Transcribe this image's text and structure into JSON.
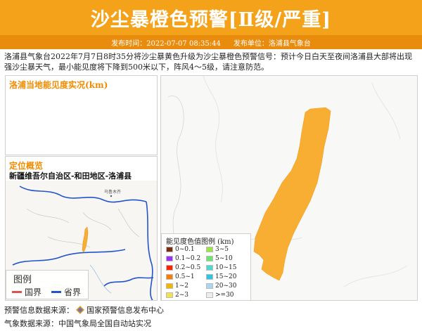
{
  "header": {
    "title": "沙尘暴橙色预警[Ⅱ级/严重]",
    "publish_time": "发布时间：2022-07-07 08:35:44",
    "publisher": "发布单位：洛浦县气象台"
  },
  "summary": "洛浦县气象台2022年7月7日8时35分将沙尘暴黄色升级为沙尘暴橙色预警信号：预计今日白天至夜间洛浦县大部将出现强沙尘暴天气，最小能见度将下降到500米以下，阵风4～5级，请注意防范。",
  "visibility_panel": {
    "title": "洛浦当地能见度实况(km)"
  },
  "location_panel": {
    "title": "定位概览",
    "region": "新疆维吾尔自治区-和田地区-洛浦县",
    "city_label": "乌鲁木齐",
    "legend": {
      "title": "图例",
      "national_border": "国界",
      "provincial_border": "省界",
      "national_color": "#d9534f",
      "provincial_color": "#2255cc"
    }
  },
  "visibility_legend": {
    "title": "能见度色值图例 (km)",
    "items": [
      {
        "label": "0~0.1",
        "color": "#7b2d12"
      },
      {
        "label": "3~5",
        "color": "#9ee24a"
      },
      {
        "label": "0.1~0.2",
        "color": "#9b30ff"
      },
      {
        "label": "5~10",
        "color": "#6fe36f"
      },
      {
        "label": "0.2~0.5",
        "color": "#ff2200"
      },
      {
        "label": "10~15",
        "color": "#4fd8d0"
      },
      {
        "label": "0.5~1",
        "color": "#ff7a00"
      },
      {
        "label": "15~20",
        "color": "#2ec4e6"
      },
      {
        "label": "1~2",
        "color": "#f5b400"
      },
      {
        "label": "20~30",
        "color": "#a8d6f2"
      },
      {
        "label": "2~3",
        "color": "#f5e14a"
      },
      {
        "label": ">=30",
        "color": "#ededed"
      }
    ]
  },
  "warning_area_color": "#f8ad33",
  "footer": {
    "warning_source": "预警信息数据来源：",
    "warning_source_name": "国家预警信息发布中心",
    "weather_source": "气象数据来源：中国气象局全国自动站实况"
  }
}
